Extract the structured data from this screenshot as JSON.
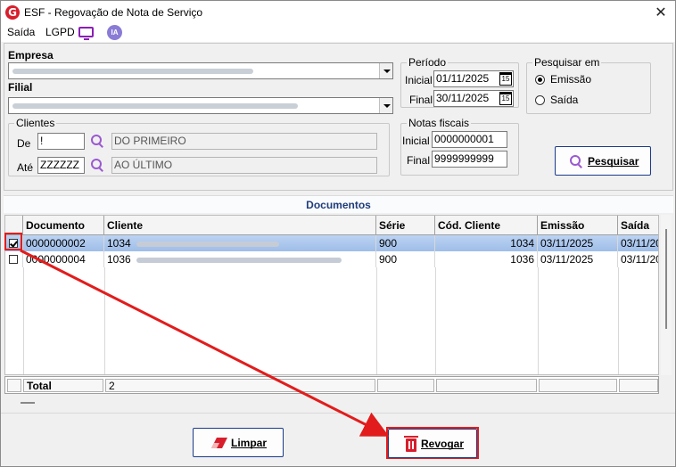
{
  "window": {
    "title": "ESF - Regovação de Nota de Serviço",
    "logo_letter": "G",
    "close_glyph": "✕"
  },
  "menu": {
    "items": [
      "Saída",
      "LGPD"
    ],
    "ia_label": "IA"
  },
  "filters": {
    "empresa_label": "Empresa",
    "filial_label": "Filial",
    "clientes_label": "Clientes",
    "de_label": "De",
    "ate_label": "Até",
    "de_value": "!",
    "ate_value": "ZZZZZZ",
    "de_desc": "DO PRIMEIRO",
    "ate_desc": "AO ÚLTIMO",
    "periodo_label": "Período",
    "inicial_label": "Inicial",
    "final_label": "Final",
    "periodo_inicial": "01/11/2025",
    "periodo_final": "30/11/2025",
    "calendar_glyph": "15",
    "notas_label": "Notas fiscais",
    "notas_inicial": "0000000001",
    "notas_final": "9999999999",
    "pesquisar_em_label": "Pesquisar em",
    "opt_emissao": "Emissão",
    "opt_saida": "Saída",
    "pesquisar_button": "Pesquisar"
  },
  "documents": {
    "section_title": "Documentos",
    "columns": [
      "Documento",
      "Cliente",
      "Série",
      "Cód. Cliente",
      "Emissão",
      "Saída"
    ],
    "rows": [
      {
        "checked": true,
        "documento": "0000000002",
        "cliente": "1034",
        "serie": "900",
        "cod_cliente": "1034",
        "emissao": "03/11/2025",
        "saida": "03/11/20"
      },
      {
        "checked": false,
        "documento": "0000000004",
        "cliente": "1036",
        "serie": "900",
        "cod_cliente": "1036",
        "emissao": "03/11/2025",
        "saida": "03/11/20"
      }
    ],
    "total_label": "Total",
    "total_value": "2"
  },
  "actions": {
    "limpar_button": "Limpar",
    "revogar_button": "Revogar"
  },
  "colors": {
    "accent_red": "#e21c1c",
    "brand_red": "#d81e2c",
    "selection": "#9ebde8",
    "header_blue": "#1f3d7a",
    "purple": "#9b59d0"
  }
}
